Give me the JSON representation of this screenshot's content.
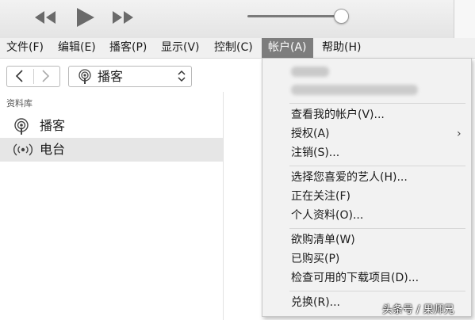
{
  "player": {
    "rewind_icon": "rewind-icon",
    "play_icon": "play-icon",
    "fastforward_icon": "fast-forward-icon",
    "volume_level": 0.9
  },
  "menubar": {
    "items": [
      {
        "label": "文件(F)"
      },
      {
        "label": "编辑(E)"
      },
      {
        "label": "播客(P)"
      },
      {
        "label": "显示(V)"
      },
      {
        "label": "控制(C)"
      },
      {
        "label": "帐户(A)",
        "active": true
      },
      {
        "label": "帮助(H)"
      }
    ]
  },
  "toolbar": {
    "media_selector_label": "播客"
  },
  "sidebar": {
    "header": "资料库",
    "items": [
      {
        "label": "播客",
        "icon": "podcast-icon"
      },
      {
        "label": "电台",
        "icon": "radio-icon",
        "selected": true
      }
    ]
  },
  "account_menu": {
    "items": [
      {
        "label": "查看我的帐户(V)..."
      },
      {
        "label": "授权(A)",
        "submenu_arrow": "›"
      },
      {
        "label": "注销(S)..."
      },
      {
        "label": "选择您喜爱的艺人(H)..."
      },
      {
        "label": "正在关注(F)"
      },
      {
        "label": "个人资料(O)..."
      },
      {
        "label": "欲购清单(W)"
      },
      {
        "label": "已购买(P)"
      },
      {
        "label": "检查可用的下载项目(D)..."
      },
      {
        "label": "兑换(R)..."
      }
    ]
  },
  "watermark": "头条号 / 果师兄",
  "colors": {
    "menu_active_bg": "#7d7d7d",
    "sidebar_selected_bg": "#e6e6e6"
  }
}
